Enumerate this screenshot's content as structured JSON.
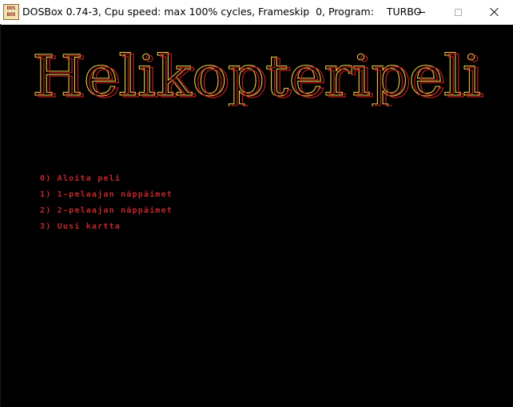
{
  "window": {
    "icon_label": "DOS BOX",
    "title": "DOSBox 0.74-3, Cpu speed: max 100% cycles, Frameskip  0, Program:    TURBO"
  },
  "game": {
    "title": "Helikopteripeli",
    "title_colors": {
      "fill": "#c21a1a",
      "outline": "#e8d24a"
    },
    "menu": [
      {
        "label": "0) Aloita peli"
      },
      {
        "label": "1) 1-pelaajan näppäimet"
      },
      {
        "label": "2) 2-pelaajan näppäimet"
      },
      {
        "label": "3) Uusi kartta"
      }
    ],
    "menu_color": "#c0282a"
  }
}
